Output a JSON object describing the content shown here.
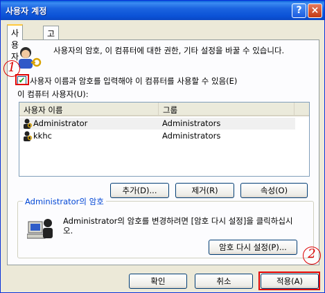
{
  "window": {
    "title": "사용자 계정",
    "help_button": "?",
    "close_button": "×"
  },
  "tabs": [
    {
      "label": "사용자",
      "active": true
    },
    {
      "label": "고급",
      "active": false
    }
  ],
  "users_tab": {
    "description": "사용자의 암호, 이 컴퓨터에 대한 권한, 기타 설정을 바꿀 수 있습니다.",
    "require_login_checkbox": {
      "label": "사용자 이름과 암호를 입력해야 이 컴퓨터를 사용할 수 있음(E)",
      "checked": true
    },
    "users_label": "이 컴퓨터 사용자(U):",
    "columns": [
      "사용자 이름",
      "그룹"
    ],
    "rows": [
      {
        "name": "Administrator",
        "group": "Administrators"
      },
      {
        "name": "kkhc",
        "group": "Administrators"
      }
    ],
    "buttons": {
      "add": "추가(D)...",
      "remove": "제거(R)",
      "properties": "속성(O)"
    },
    "password_group": {
      "title": "Administrator의 암호",
      "text": "Administrator의 암호를 변경하려면 [암호 다시 설정]을 클릭하십시오.",
      "reset_button": "암호 다시 설정(P)..."
    }
  },
  "footer": {
    "ok": "확인",
    "cancel": "취소",
    "apply": "적용(A)"
  },
  "annotations": {
    "one": "1",
    "two": "2"
  },
  "colors": {
    "title_bar": "#0A5FD9",
    "annotation": "#DD0000",
    "group_label": "#0046D5"
  }
}
